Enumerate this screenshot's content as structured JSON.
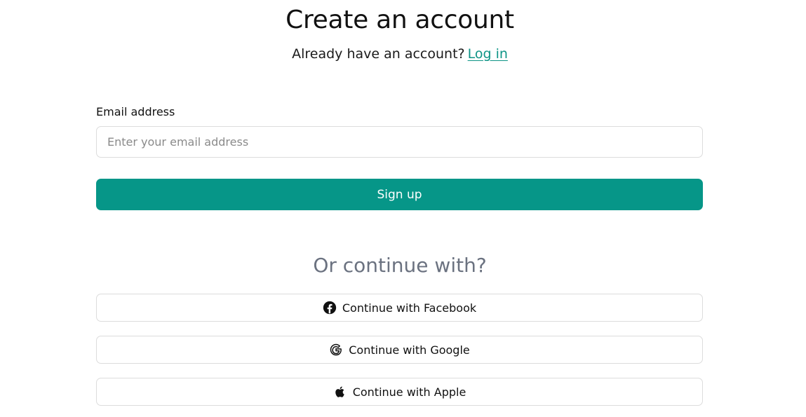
{
  "header": {
    "title": "Create an account",
    "subtitle": "Already have an account?",
    "login_link": "Log in"
  },
  "form": {
    "email_label": "Email address",
    "email_placeholder": "Enter your email address",
    "signup_label": "Sign up"
  },
  "social": {
    "divider_text": "Or continue with?",
    "facebook_label": "Continue with Facebook",
    "google_label": "Continue with Google",
    "apple_label": "Continue with Apple"
  },
  "colors": {
    "accent": "#069688",
    "link": "#0e9486",
    "muted": "#6b7280",
    "border": "#dcdcdc"
  },
  "icons": [
    "facebook-icon",
    "google-icon",
    "apple-icon"
  ]
}
